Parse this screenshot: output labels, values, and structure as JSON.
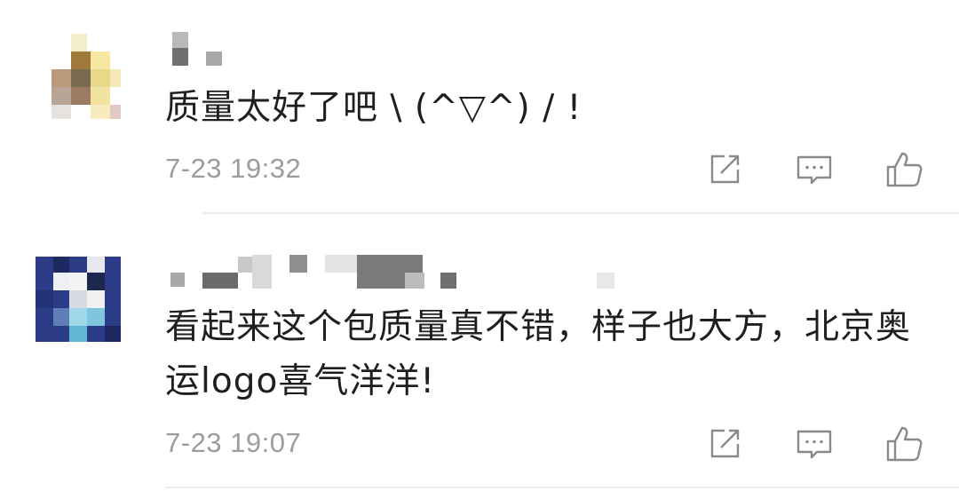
{
  "comments": [
    {
      "text": "质量太好了吧 \\ (^▽^) / !",
      "timestamp": "7-23 19:32",
      "actions": {
        "share_icon": "share-icon",
        "reply_icon": "reply-icon",
        "like_icon": "like-icon"
      }
    },
    {
      "text": "看起来这个包质量真不错，样子也大方，北京奥运logo喜气洋洋!",
      "timestamp": "7-23 19:07",
      "actions": {
        "share_icon": "share-icon",
        "reply_icon": "reply-icon",
        "like_icon": "like-icon"
      }
    }
  ],
  "colors": {
    "text": "#1f1f1f",
    "timestamp": "#9c9c9c",
    "icon": "#8a8a8a",
    "divider": "#ececec"
  }
}
